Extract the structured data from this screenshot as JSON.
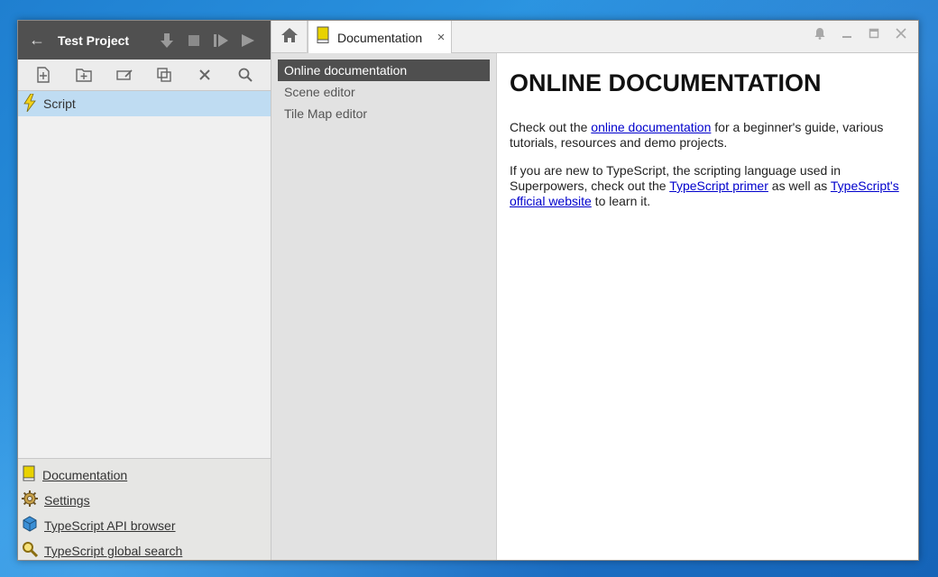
{
  "project": {
    "title": "Test Project",
    "back_icon": "back-arrow-icon",
    "header_buttons": [
      "download-icon",
      "stop-icon",
      "step-play-icon",
      "play-icon"
    ]
  },
  "toolbar": {
    "buttons": [
      "new-asset-icon",
      "new-folder-icon",
      "rename-icon",
      "duplicate-icon",
      "delete-icon",
      "search-icon"
    ]
  },
  "tree": {
    "items": [
      {
        "label": "Script",
        "icon": "lightning-icon",
        "selected": true
      }
    ]
  },
  "bottom_links": [
    {
      "label": "Documentation",
      "icon": "book-icon"
    },
    {
      "label": "Settings",
      "icon": "gear-icon"
    },
    {
      "label": "TypeScript API browser",
      "icon": "cube-icon"
    },
    {
      "label": "TypeScript global search",
      "icon": "magnifier-icon"
    }
  ],
  "tabs": {
    "home_icon": "home-icon",
    "active": {
      "label": "Documentation",
      "icon": "book-icon",
      "close": "×"
    }
  },
  "window_controls": [
    "bell-icon",
    "minimize-icon",
    "maximize-icon",
    "close-icon"
  ],
  "doc_nav": [
    {
      "label": "Online documentation",
      "active": true
    },
    {
      "label": "Scene editor",
      "active": false
    },
    {
      "label": "Tile Map editor",
      "active": false
    }
  ],
  "content": {
    "title": "ONLINE DOCUMENTATION",
    "p1_before": "Check out the ",
    "p1_link": "online documentation",
    "p1_after": " for a beginner's guide, various tutorials, resources and demo projects.",
    "p2_before": "If you are new to TypeScript, the scripting language used in Superpowers, check out the ",
    "p2_link1": "TypeScript primer",
    "p2_middle": " as well as ",
    "p2_link2": "TypeScript's official website",
    "p2_after": " to learn it."
  },
  "colors": {
    "header_bg": "#505050",
    "selected_bg": "#bfdcf2",
    "nav_active_bg": "#4f4f4f",
    "link": "#0000cc",
    "book_yellow": "#e8d200"
  }
}
